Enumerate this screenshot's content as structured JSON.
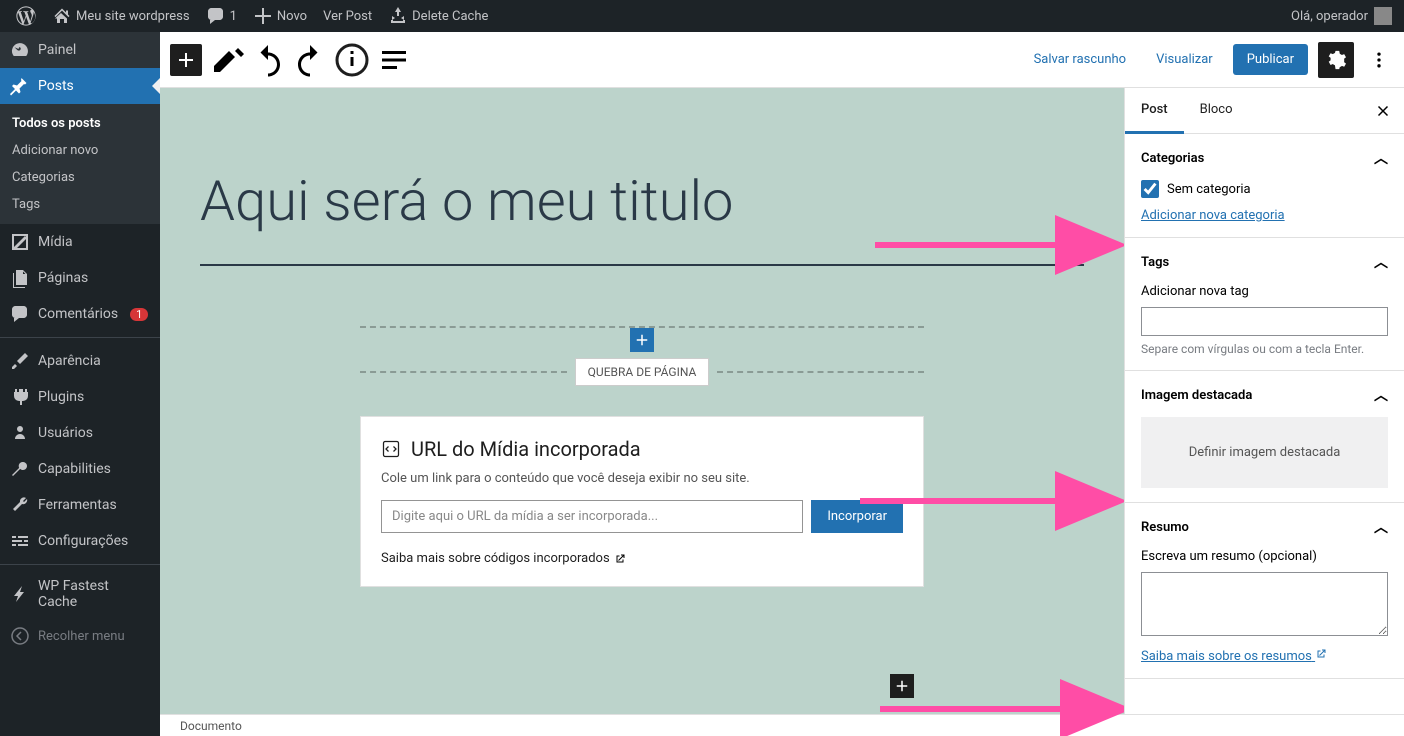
{
  "adminbar": {
    "site_name": "Meu site wordpress",
    "comments_count": "1",
    "new": "Novo",
    "view_post": "Ver Post",
    "delete_cache": "Delete Cache",
    "greeting": "Olá, operador"
  },
  "sidebar": {
    "dashboard": "Painel",
    "posts": "Posts",
    "posts_sub": {
      "all": "Todos os posts",
      "add": "Adicionar novo",
      "categories": "Categorias",
      "tags": "Tags"
    },
    "media": "Mídia",
    "pages": "Páginas",
    "comments": "Comentários",
    "comments_badge": "1",
    "appearance": "Aparência",
    "plugins": "Plugins",
    "users": "Usuários",
    "capabilities": "Capabilities",
    "tools": "Ferramentas",
    "settings": "Configurações",
    "wpfc": "WP Fastest Cache",
    "collapse": "Recolher menu"
  },
  "topbar": {
    "save_draft": "Salvar rascunho",
    "preview": "Visualizar",
    "publish": "Publicar"
  },
  "post": {
    "title": "Aqui será o meu titulo",
    "page_break": "QUEBRA DE PÁGINA"
  },
  "embed": {
    "title": "URL do Mídia incorporada",
    "desc": "Cole um link para o conteúdo que você deseja exibir no seu site.",
    "placeholder": "Digite aqui o URL da mídia a ser incorporada...",
    "button": "Incorporar",
    "learn_more": "Saiba mais sobre códigos incorporados"
  },
  "footer": {
    "breadcrumb": "Documento"
  },
  "inspector": {
    "tab_post": "Post",
    "tab_block": "Bloco",
    "categories": {
      "title": "Categorias",
      "uncat": "Sem categoria",
      "add": "Adicionar nova categoria"
    },
    "tags": {
      "title": "Tags",
      "add_label": "Adicionar nova tag",
      "hint": "Separe com vírgulas ou com a tecla Enter."
    },
    "featured": {
      "title": "Imagem destacada",
      "set": "Definir imagem destacada"
    },
    "summary": {
      "title": "Resumo",
      "label": "Escreva um resumo (opcional)",
      "learn_more": "Saiba mais sobre os resumos"
    }
  }
}
